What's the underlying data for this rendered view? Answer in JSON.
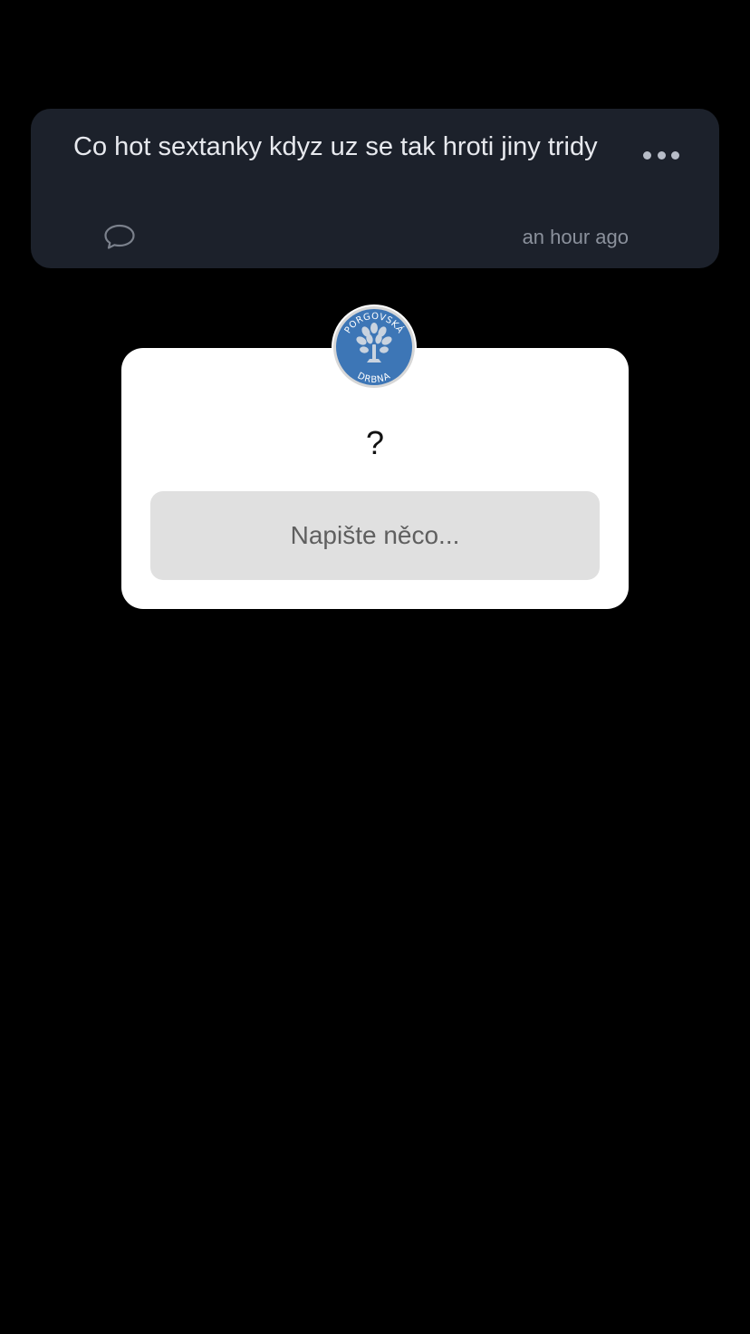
{
  "post": {
    "text": "Co hot sextanky kdyz uz se tak hroti jiny tridy",
    "timestamp": "an hour ago",
    "more_icon": "more-horizontal-icon",
    "comment_icon": "comment-bubble-icon"
  },
  "modal": {
    "avatar_text_top": "PORGOVSKÁ",
    "avatar_text_bottom": "DRBNA",
    "question": "?",
    "input_placeholder": "Napište něco...",
    "input_value": ""
  },
  "colors": {
    "background": "#000000",
    "card": "#1c212b",
    "avatar_blue": "#3d76b6",
    "input_bg": "#e0e0e0"
  }
}
